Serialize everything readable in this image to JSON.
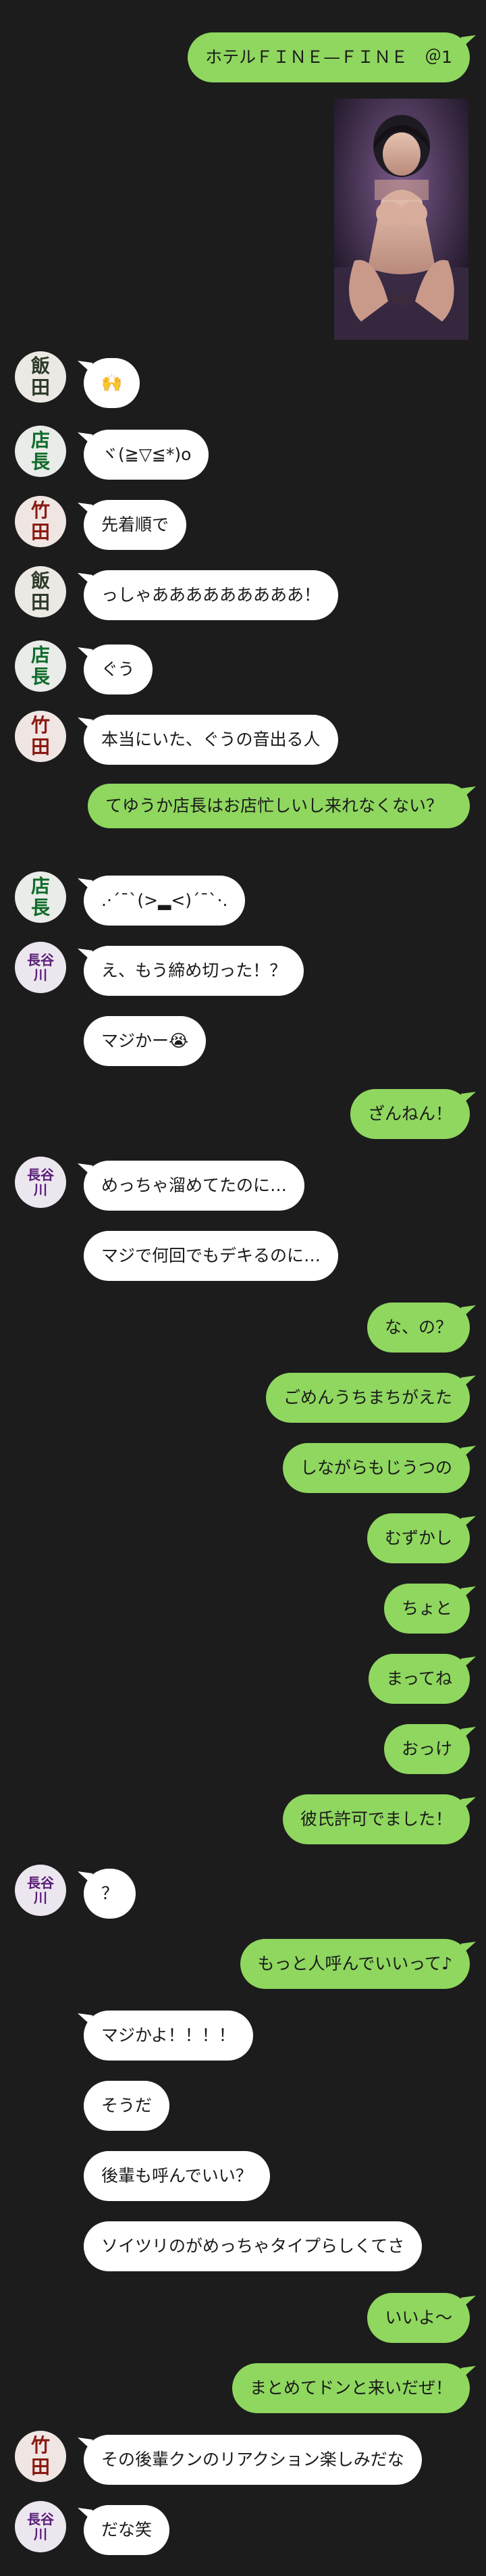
{
  "messages": [
    {
      "id": "m1",
      "side": "out",
      "text": "ホテルＦＩＮＥ—ＦＩＮＥ　＠1"
    },
    {
      "id": "m2",
      "side": "out",
      "type": "image",
      "alt": "photo"
    },
    {
      "id": "m3",
      "side": "in",
      "speaker": "飯田",
      "text": "🙌"
    },
    {
      "id": "m4",
      "side": "in",
      "speaker": "店長",
      "text": "ヾ(≧▽≦*)o"
    },
    {
      "id": "m5",
      "side": "in",
      "speaker": "竹田",
      "text": "先着順で"
    },
    {
      "id": "m6",
      "side": "in",
      "speaker": "飯田",
      "text": "っしゃあああああああああ！"
    },
    {
      "id": "m7",
      "side": "in",
      "speaker": "店長",
      "text": "ぐう"
    },
    {
      "id": "m8",
      "side": "in",
      "speaker": "竹田",
      "text": "本当にいた、ぐうの音出る人"
    },
    {
      "id": "m9",
      "side": "out",
      "text": "てゆうか店長はお店忙しいし来れなくない？"
    },
    {
      "id": "m10",
      "side": "in",
      "speaker": "店長",
      "text": ".·´¯`(>▂<)´¯`·."
    },
    {
      "id": "m11",
      "side": "in",
      "speaker": "長谷川",
      "text": "え、もう締め切った！？"
    },
    {
      "id": "m12",
      "side": "in",
      "text": "マジかー😭"
    },
    {
      "id": "m13",
      "side": "out",
      "text": "ざんねん！"
    },
    {
      "id": "m14",
      "side": "in",
      "speaker": "長谷川",
      "text": "めっちゃ溜めてたのに…"
    },
    {
      "id": "m15",
      "side": "in",
      "text": "マジで何回でもデキるのに…"
    },
    {
      "id": "m16",
      "side": "out",
      "text": "な、の？"
    },
    {
      "id": "m17",
      "side": "out",
      "text": "ごめんうちまちがえた"
    },
    {
      "id": "m18",
      "side": "out",
      "text": "しながらもじうつの"
    },
    {
      "id": "m19",
      "side": "out",
      "text": "むずかし"
    },
    {
      "id": "m20",
      "side": "out",
      "text": "ちょと"
    },
    {
      "id": "m21",
      "side": "out",
      "text": "まってね"
    },
    {
      "id": "m22",
      "side": "out",
      "text": "おっけ"
    },
    {
      "id": "m23",
      "side": "out",
      "text": "彼氏許可でました！"
    },
    {
      "id": "m24",
      "side": "in",
      "speaker": "長谷川",
      "text": "？"
    },
    {
      "id": "m25",
      "side": "out",
      "text": "もっと人呼んでいいって♪"
    },
    {
      "id": "m26",
      "side": "in",
      "text": "マジかよ！！！！"
    },
    {
      "id": "m27",
      "side": "in",
      "text": "そうだ"
    },
    {
      "id": "m28",
      "side": "in",
      "text": "後輩も呼んでいい？"
    },
    {
      "id": "m29",
      "side": "in",
      "text": "ソイツリのがめっちゃタイプらしくてさ"
    },
    {
      "id": "m30",
      "side": "out",
      "text": "いいよ～"
    },
    {
      "id": "m31",
      "side": "out",
      "text": "まとめてドンと来いだぜ！"
    },
    {
      "id": "m32",
      "side": "in",
      "speaker": "竹田",
      "text": "その後輩クンのリアクション楽しみだな"
    },
    {
      "id": "m33",
      "side": "in",
      "speaker": "長谷川",
      "text": "だな笑"
    }
  ],
  "colors": {
    "background": "#1c1c1c",
    "outgoing_bubble": "#8fd75f",
    "incoming_bubble": "#ffffff"
  }
}
